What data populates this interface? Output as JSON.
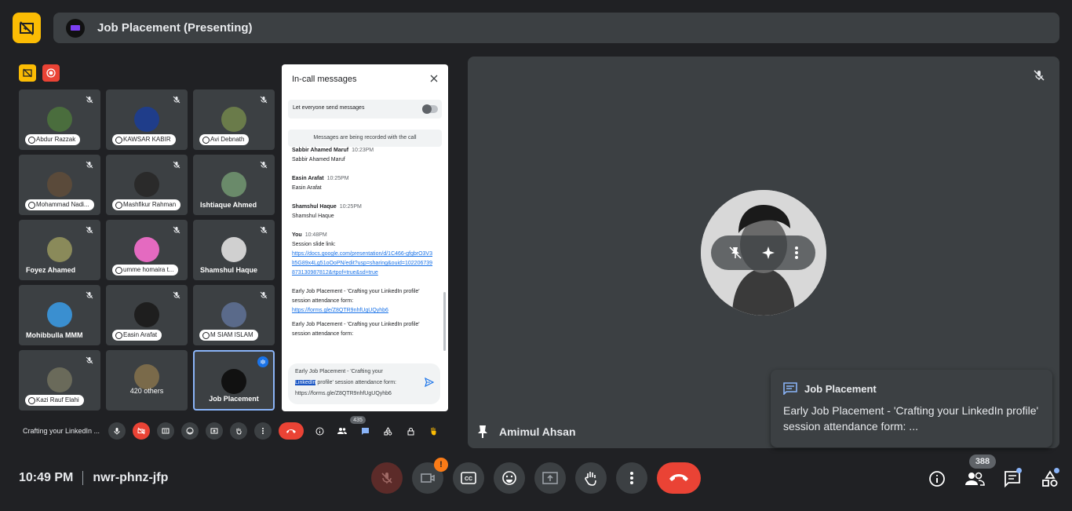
{
  "topbar": {
    "title": "Job Placement (Presenting)"
  },
  "participants": [
    {
      "name": "Abdur Razzak",
      "style": "pill",
      "avatar": "#4a6d3d"
    },
    {
      "name": "KAWSAR KABIR",
      "style": "pill",
      "avatar": "#1f3d8a"
    },
    {
      "name": "Avi Debnath",
      "style": "pill",
      "avatar": "#6a7b4a"
    },
    {
      "name": "Mohammad Nadi...",
      "style": "pill",
      "avatar": "#5a4a3a"
    },
    {
      "name": "Mashfikur Rahman",
      "style": "pill",
      "avatar": "#2a2a2a"
    },
    {
      "name": "Ishtiaque Ahmed",
      "style": "plain",
      "avatar": "#6a8a6a"
    },
    {
      "name": "Foyez Ahamed",
      "style": "plain",
      "avatar": "#8a8a5a"
    },
    {
      "name": "umme homaira t...",
      "style": "pill",
      "avatar": "#e46ac0"
    },
    {
      "name": "Shamshul Haque",
      "style": "plain",
      "avatar": "#d0d0d0"
    },
    {
      "name": "Mohibbulla MMM",
      "style": "plain",
      "avatar": "#3a8fd0"
    },
    {
      "name": "Easin Arafat",
      "style": "pill",
      "avatar": "#1e1e1e"
    },
    {
      "name": "M SIAM ISLAM",
      "style": "pill",
      "avatar": "#5a6a8a"
    },
    {
      "name": "Kazi Rauf Elahi",
      "style": "pill",
      "avatar": "#6a6a5a"
    },
    {
      "name": "420 others",
      "style": "center",
      "avatar": "#7a6a4a"
    },
    {
      "name": "Job Placement",
      "style": "plain",
      "avatar": "#111111"
    }
  ],
  "mini_toolbar": {
    "title": "Crafting your LinkedIn ...",
    "count": "435"
  },
  "chat": {
    "header": "In-call messages",
    "toggle_label": "Let everyone send messages",
    "notice": "Messages are being recorded with the call",
    "messages": [
      {
        "sender": "Sabbir Ahamed Maruf",
        "time": "10:23PM",
        "text": "Sabbir Ahamed Maruf",
        "link": ""
      },
      {
        "sender": "Easin Arafat",
        "time": "10:25PM",
        "text": "Easin Arafat",
        "link": ""
      },
      {
        "sender": "Shamshul Haque",
        "time": "10:25PM",
        "text": "Shamshul Haque",
        "link": ""
      },
      {
        "sender": "You",
        "time": "10:48PM",
        "text": "Session slide link:",
        "link": "https://docs.google.com/presentation/d/1C466-gfgbrO3V3lt5G89x4Lg51oOoPN/edit?usp=sharing&ouid=102206739873130987812&rtpof=true&sd=true"
      },
      {
        "sender": "",
        "time": "",
        "text": "Early Job Placement - 'Crafting your LinkedIn profile' session attendance form:",
        "link": "https://forms.gle/Z8QTR9nhfUgUQyhb6"
      },
      {
        "sender": "",
        "time": "",
        "text": "Early Job Placement - 'Crafting your LinkedIn profile' session attendance form:",
        "link": ""
      }
    ],
    "compose": {
      "line1": "Early Job Placement - 'Crafting your",
      "selected": "LinkedIn",
      "line2_rest": " profile' session attendance form:",
      "line3": "https://forms.gle/Z8QTR9nhfUgUQyhb6"
    }
  },
  "stage": {
    "name": "Amimul Ahsan"
  },
  "toast": {
    "title": "Job Placement",
    "body": "Early Job Placement - 'Crafting your LinkedIn profile' session attendance form: ..."
  },
  "bottom": {
    "time": "10:49 PM",
    "meeting_code": "nwr-phnz-jfp",
    "people_count": "388",
    "camera_warning": "!"
  },
  "colors": {
    "accent_yellow": "#fbbc04",
    "end_red": "#ea4335",
    "link_blue": "#1a73e8",
    "highlight_blue": "#8ab4f8"
  }
}
